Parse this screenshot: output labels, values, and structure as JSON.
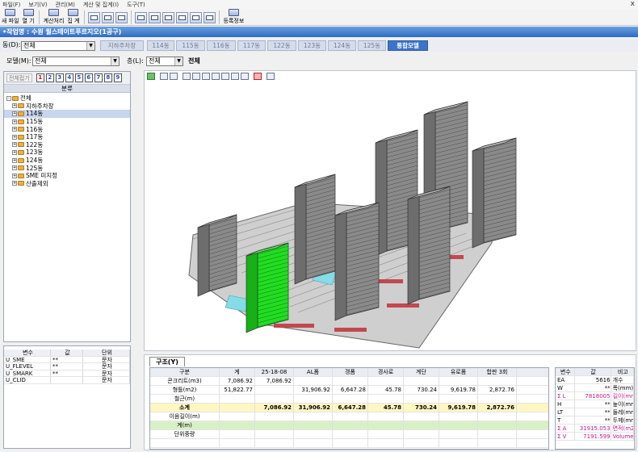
{
  "menu": [
    "파일(F)",
    "보기(V)",
    "관리(M)",
    "계산 및 집계(I)",
    "도구(T)"
  ],
  "window_close": "x",
  "toolbar": {
    "new_file": "새 파일",
    "open": "열 기",
    "calc": "계산처리",
    "tally": "집 계",
    "register": "등록정보"
  },
  "title": "•작업명 : 수원 월스테이트푸르지오(1공구)",
  "dong": {
    "label": "동(D):",
    "value": "전체",
    "tabs": [
      "지하주차장",
      "114동",
      "115동",
      "116동",
      "117동",
      "122동",
      "123동",
      "124동",
      "125동",
      "통합모델"
    ],
    "active_tab": "통합모델"
  },
  "model": {
    "label": "모델(M):",
    "value": "전체",
    "floor_label": "층(L):",
    "floor_value": "전체",
    "floor_display": "전체"
  },
  "tree": {
    "collapse_label": "전체접기",
    "levels": [
      "1",
      "2",
      "3",
      "4",
      "5",
      "6",
      "7",
      "8",
      "9"
    ],
    "header": "분류",
    "items": [
      {
        "label": "전체",
        "depth": 0,
        "expand": "-"
      },
      {
        "label": "지하주차장",
        "depth": 1,
        "expand": "+"
      },
      {
        "label": "114동",
        "depth": 1,
        "expand": "+",
        "selected": true
      },
      {
        "label": "115동",
        "depth": 1,
        "expand": "+"
      },
      {
        "label": "116동",
        "depth": 1,
        "expand": "+"
      },
      {
        "label": "117동",
        "depth": 1,
        "expand": "+"
      },
      {
        "label": "122동",
        "depth": 1,
        "expand": "+"
      },
      {
        "label": "123동",
        "depth": 1,
        "expand": "+"
      },
      {
        "label": "124동",
        "depth": 1,
        "expand": "+"
      },
      {
        "label": "125동",
        "depth": 1,
        "expand": "+"
      },
      {
        "label": "SME 미지정",
        "depth": 1,
        "expand": "+"
      },
      {
        "label": "산출제외",
        "depth": 1,
        "expand": "+"
      }
    ]
  },
  "vars": {
    "headers": [
      "변수",
      "값",
      "단위"
    ],
    "rows": [
      [
        "U_SME",
        "**",
        "문자"
      ],
      [
        "U_FLEVEL",
        "**",
        "문자"
      ],
      [
        "U_SMARK",
        "**",
        "문자"
      ],
      [
        "U_CLID",
        "",
        "문자"
      ]
    ]
  },
  "bottom": {
    "tab": "구조(Y)",
    "headers": [
      "구분",
      "계",
      "25-18-08",
      "AL폼",
      "갱폼",
      "경사로",
      "계단",
      "유로폼",
      "합판 3회"
    ],
    "rows": [
      {
        "cls": "",
        "cells": [
          "콘크리트(m3)",
          "7,086.92",
          "7,086.92",
          "",
          "",
          "",
          "",
          "",
          ""
        ]
      },
      {
        "cls": "",
        "cells": [
          "형틀(m2)",
          "51,822.77",
          "",
          "31,906.92",
          "6,647.28",
          "45.78",
          "730.24",
          "9,619.78",
          "2,872.76"
        ]
      },
      {
        "cls": "",
        "cells": [
          "철근(m)",
          "",
          "",
          "",
          "",
          "",
          "",
          "",
          ""
        ]
      },
      {
        "cls": "yel",
        "cells": [
          "소계",
          "",
          "7,086.92",
          "31,906.92",
          "6,647.28",
          "45.78",
          "730.24",
          "9,619.78",
          "2,872.76"
        ]
      },
      {
        "cls": "",
        "cells": [
          "이음길이(m)",
          "",
          "",
          "",
          "",
          "",
          "",
          "",
          ""
        ]
      },
      {
        "cls": "grn",
        "cells": [
          "계(m)",
          "",
          "",
          "",
          "",
          "",
          "",
          "",
          ""
        ]
      },
      {
        "cls": "",
        "cells": [
          "단위중량",
          "",
          "",
          "",
          "",
          "",
          "",
          "",
          ""
        ]
      },
      {
        "cls": "",
        "cells": [
          "",
          "",
          "",
          "",
          "",
          "",
          "",
          "",
          ""
        ]
      }
    ]
  },
  "props": {
    "headers": [
      "변수",
      "값",
      "비고"
    ],
    "rows": [
      {
        "name": "EA",
        "value": "5616",
        "note": "개수",
        "mag": false
      },
      {
        "name": "W",
        "value": "**",
        "note": "폭(mm)",
        "mag": false
      },
      {
        "name": "Σ L",
        "value": "7818005",
        "note": "길이(mm)",
        "mag": true
      },
      {
        "name": "H",
        "value": "**",
        "note": "높이(mm)",
        "mag": false
      },
      {
        "name": "LT",
        "value": "**",
        "note": "둘레(mm)",
        "mag": false
      },
      {
        "name": "T",
        "value": "**",
        "note": "두께(mm)",
        "mag": false
      },
      {
        "name": "Σ A",
        "value": "31915.053",
        "note": "면적(m2)",
        "mag": true
      },
      {
        "name": "Σ V",
        "value": "7191.599",
        "note": "Volume",
        "mag": true
      }
    ]
  },
  "colors": {
    "accent": "#3d74c8",
    "highlight_green": "#22dd22",
    "building": "#8a8a8a",
    "roof_red": "#c0303a"
  }
}
